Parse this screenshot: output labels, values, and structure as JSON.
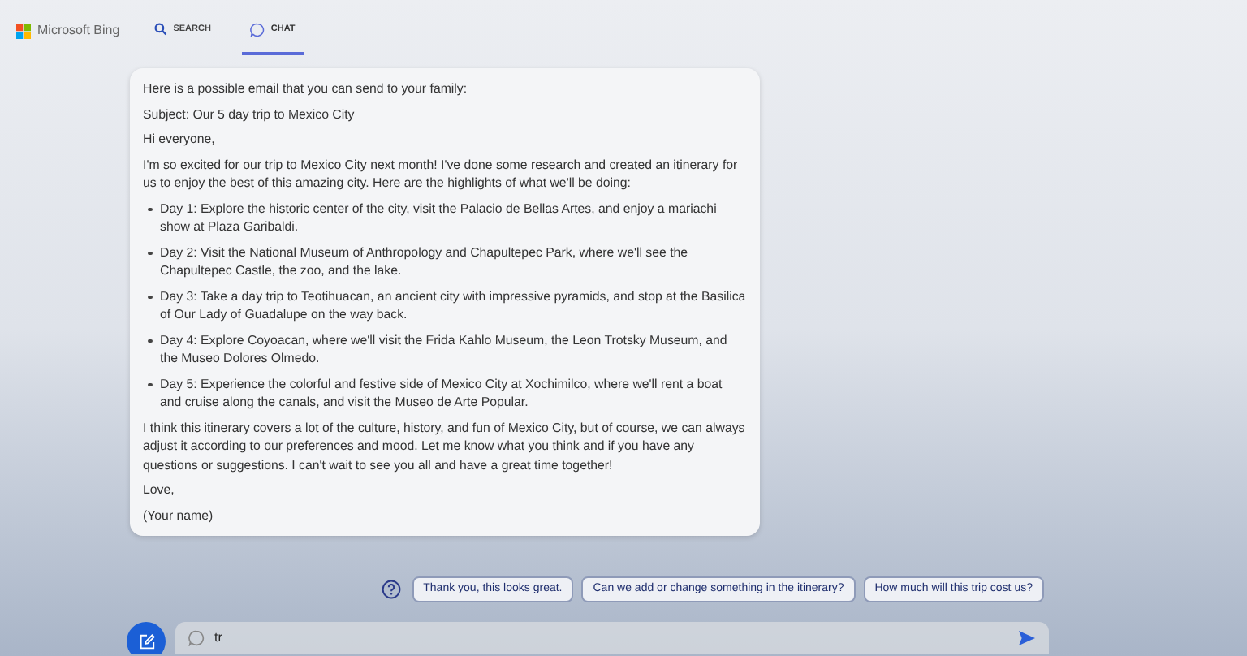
{
  "header": {
    "logo_text": "Microsoft Bing",
    "tabs": [
      {
        "label": "SEARCH",
        "kind": "search",
        "selected": false
      },
      {
        "label": "CHAT",
        "kind": "chat",
        "selected": true
      }
    ]
  },
  "message": {
    "blocks": [
      {
        "kind": "paragraph",
        "text": "Here is a possible email that you can send to your family:"
      },
      {
        "kind": "paragraph",
        "text": "Subject: Our 5 day trip to Mexico City"
      },
      {
        "kind": "paragraph",
        "text": "Hi everyone,"
      },
      {
        "kind": "paragraph",
        "text": "I'm so excited for our trip to Mexico City next month! I've done some research and created an itinerary for us to enjoy the best of this amazing city. Here are the highlights of what we'll be doing:"
      },
      {
        "kind": "bullet",
        "text": "Day 1: Explore the historic center of the city, visit the Palacio de Bellas Artes, and enjoy a mariachi show at Plaza Garibaldi."
      },
      {
        "kind": "bullet",
        "text": "Day 2: Visit the National Museum of Anthropology and Chapultepec Park, where we'll see the Chapultepec Castle, the zoo, and the lake."
      },
      {
        "kind": "bullet",
        "text": "Day 3: Take a day trip to Teotihuacan, an ancient city with impressive pyramids, and stop at the Basilica of Our Lady of Guadalupe on the way back."
      },
      {
        "kind": "bullet",
        "text": "Day 4: Explore Coyoacan, where we'll visit the Frida Kahlo Museum, the Leon Trotsky Museum, and the Museo Dolores Olmedo."
      },
      {
        "kind": "bullet",
        "text": "Day 5: Experience the colorful and festive side of Mexico City at Xochimilco, where we'll rent a boat and cruise along the canals, and visit the Museo de Arte Popular."
      },
      {
        "kind": "paragraph",
        "text": "I think this itinerary covers a lot of the culture, history, and fun of Mexico City, but of course, we can always adjust it according to our preferences and mood. Let me know what you think and if you have any questions or suggestions. I can't wait to see you all and have a great time together!"
      },
      {
        "kind": "paragraph",
        "text": "Love,"
      },
      {
        "kind": "paragraph",
        "text": "(Your name)"
      }
    ]
  },
  "suggestions": [
    "Thank you, this looks great.",
    "Can we add or change something in the itinerary?",
    "How much will this trip cost us?"
  ],
  "composer": {
    "value": "tr"
  }
}
